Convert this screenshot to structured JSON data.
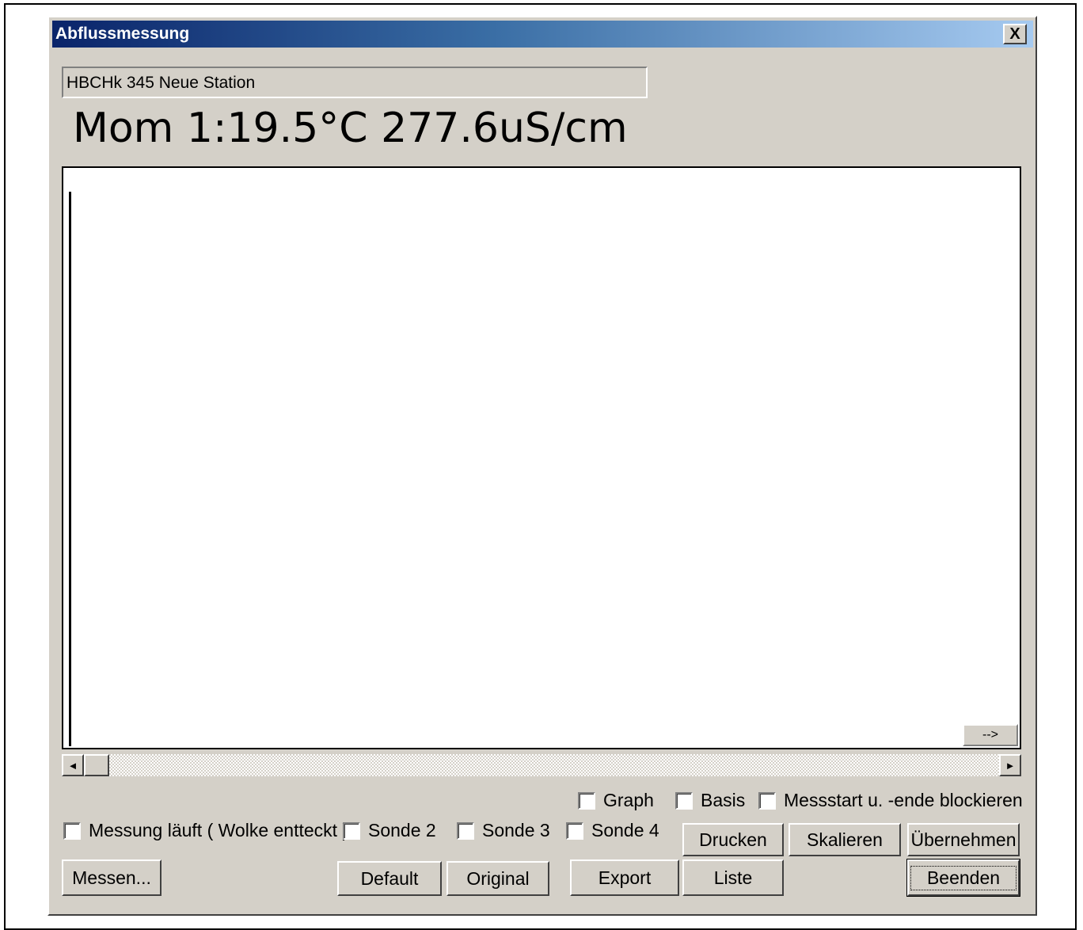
{
  "window": {
    "title": "Abflussmessung",
    "close_symbol": "X"
  },
  "station": "HBCHk 345 Neue Station",
  "reading": "Mom 1:19.5°C 277.6uS/cm",
  "graph": {
    "arrow_label": "-->"
  },
  "scrollbar": {
    "left_arrow": "◄",
    "right_arrow": "►"
  },
  "checkboxes": {
    "graph": "Graph",
    "basis": "Basis",
    "messstart": "Messstart u. -ende blockieren",
    "messung_laeuft": "Messung läuft ( Wolke entteckt )",
    "sonde2": "Sonde 2",
    "sonde3": "Sonde 3",
    "sonde4": "Sonde 4"
  },
  "buttons": {
    "drucken": "Drucken",
    "skalieren": "Skalieren",
    "uebernehmen": "Übernehmen",
    "messen": "Messen...",
    "default": "Default",
    "original": "Original",
    "export": "Export",
    "liste": "Liste",
    "beenden": "Beenden"
  }
}
